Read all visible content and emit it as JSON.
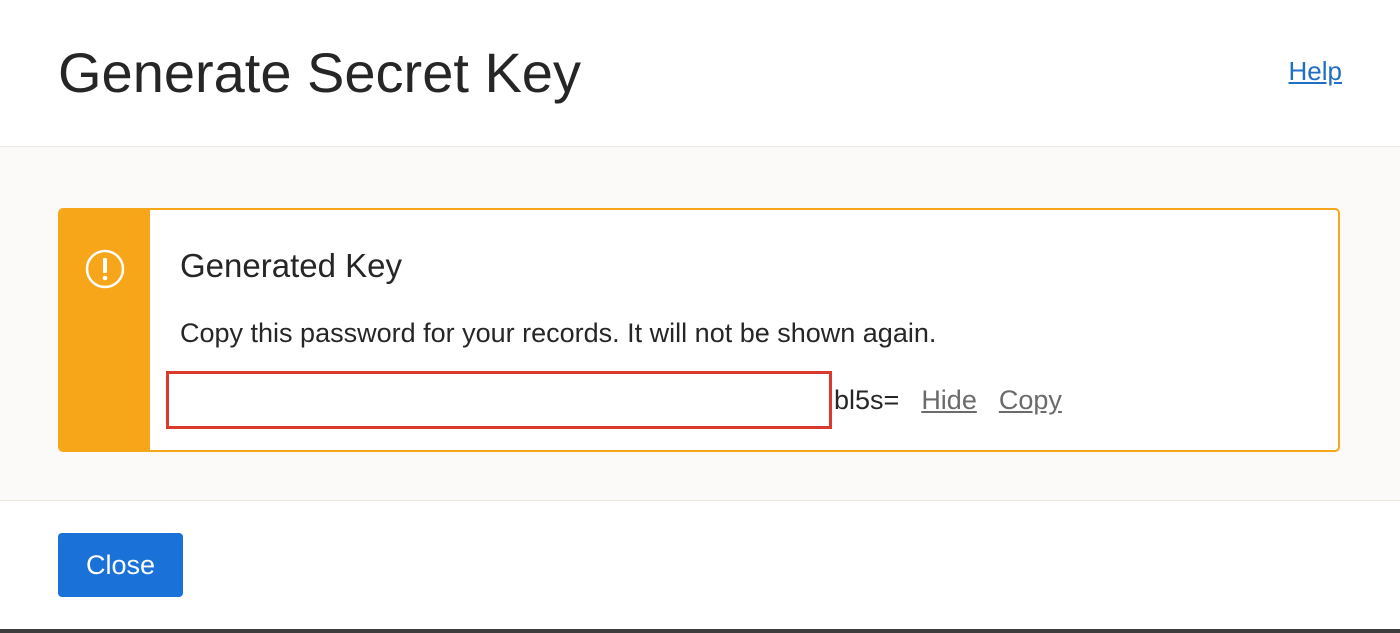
{
  "dialog": {
    "title": "Generate Secret Key",
    "help_label": "Help"
  },
  "alert": {
    "icon": "exclamation-circle-icon",
    "accent_color": "#f8a619",
    "title": "Generated Key",
    "message": "Copy this password for your records. It will not be shown again.",
    "key_suffix": "bl5s=",
    "hide_label": "Hide",
    "copy_label": "Copy"
  },
  "footer": {
    "close_label": "Close",
    "close_color": "#1a72d8"
  }
}
